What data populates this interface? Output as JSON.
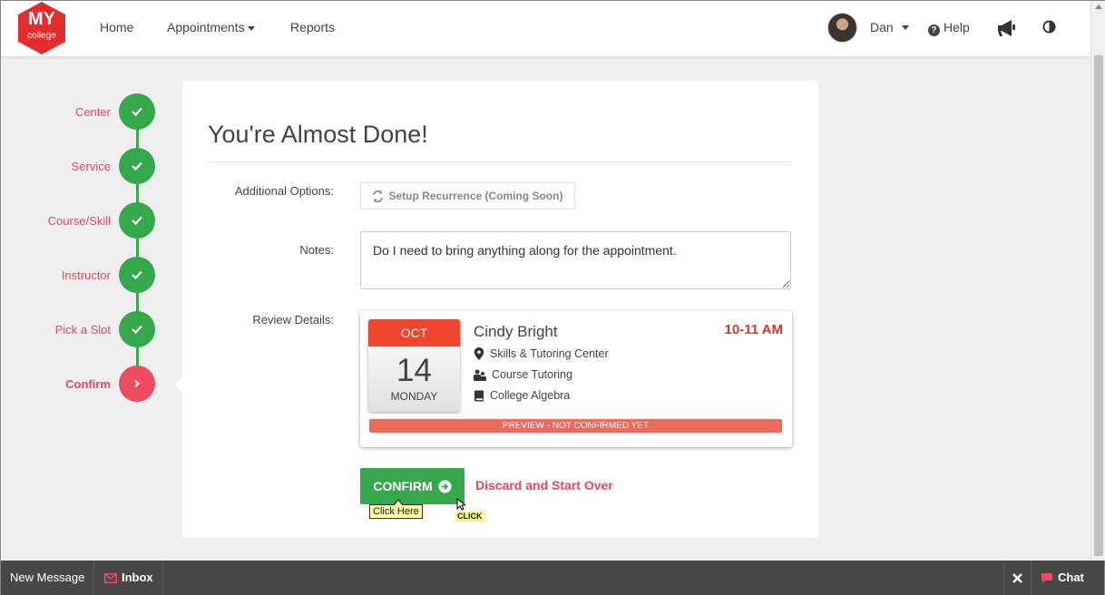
{
  "brand": {
    "logo_top": "MY",
    "logo_bottom": "college",
    "color": "#e32d2d"
  },
  "nav": {
    "items": [
      "Home",
      "Appointments",
      "Reports"
    ],
    "user_name": "Dan",
    "help_label": "Help"
  },
  "steps": [
    {
      "label": "Center",
      "status": "done"
    },
    {
      "label": "Service",
      "status": "done"
    },
    {
      "label": "Course/Skill",
      "status": "done"
    },
    {
      "label": "Instructor",
      "status": "done"
    },
    {
      "label": "Pick a Slot",
      "status": "done"
    },
    {
      "label": "Confirm",
      "status": "active"
    }
  ],
  "form": {
    "title": "You're Almost Done!",
    "additional_options_label": "Additional Options:",
    "recurrence_button": "Setup Recurrence (Coming Soon)",
    "notes_label": "Notes:",
    "notes_value": "Do I need to bring anything along for the appointment.",
    "review_label": "Review Details:"
  },
  "review": {
    "month": "OCT",
    "day": "14",
    "weekday": "MONDAY",
    "instructor": "Cindy Bright",
    "time": "10-11 AM",
    "center": "Skills & Tutoring Center",
    "service": "Course Tutoring",
    "course": "College Algebra",
    "status_banner": "PREVIEW - NOT CONFIRMED YET"
  },
  "actions": {
    "confirm": "CONFIRM",
    "discard": "Discard and Start Over",
    "tooltip": "Click Here",
    "click_tag": "CLICK"
  },
  "bottom_bar": {
    "new_message": "New Message",
    "inbox": "Inbox",
    "chat": "Chat"
  },
  "colors": {
    "accent_red": "#e8475a",
    "success_green": "#34a84a",
    "calendar_red": "#f0462f",
    "time_red": "#d9342c"
  }
}
